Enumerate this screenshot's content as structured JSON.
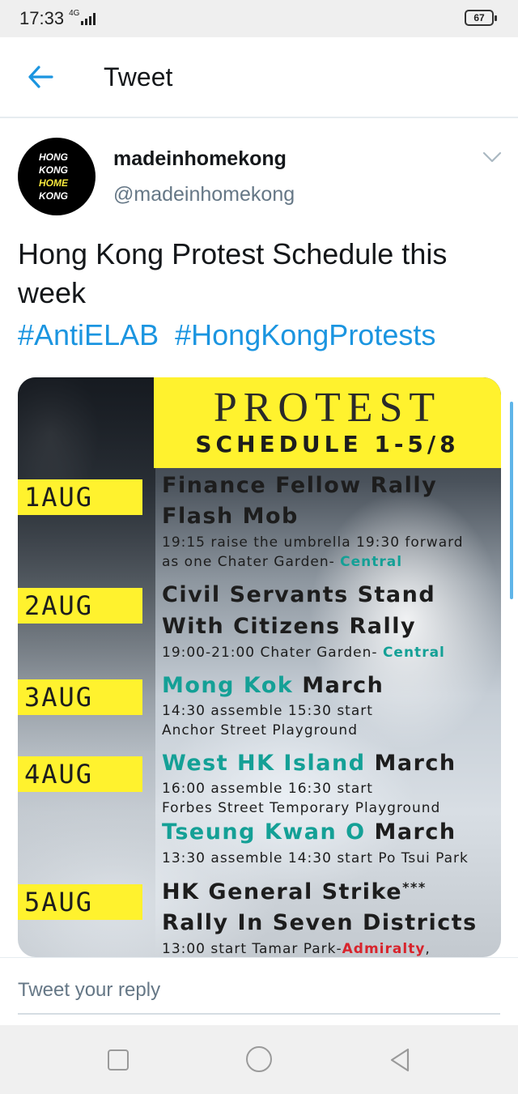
{
  "status_bar": {
    "time": "17:33",
    "network": "4G",
    "battery": "67"
  },
  "app_bar": {
    "title": "Tweet",
    "back_icon": "arrow-left-icon"
  },
  "tweet": {
    "avatar": {
      "line1": "HONG",
      "line2": "KONG",
      "line3": "HOME",
      "line4": "KONG"
    },
    "display_name": "madeinhomekong",
    "handle": "@madeinhomekong",
    "text": "Hong Kong Protest Schedule this week",
    "hashtags": [
      "#AntiELAB",
      "#HongKongProtests"
    ]
  },
  "poster": {
    "title": "PROTEST",
    "subtitle": "SCHEDULE 1-5/8",
    "days": [
      {
        "tag": "1AUG",
        "lines": [
          {
            "parts": [
              {
                "text": "Finance Fellow Rally",
                "style": ""
              }
            ]
          },
          {
            "parts": [
              {
                "text": "Flash Mob",
                "style": ""
              }
            ]
          }
        ],
        "subs": [
          {
            "parts": [
              {
                "text": "19:15 raise the umbrella  19:30 forward",
                "style": ""
              }
            ]
          },
          {
            "parts": [
              {
                "text": "as one  Chater Garden- ",
                "style": ""
              },
              {
                "text": "Central",
                "style": "teal"
              }
            ]
          }
        ]
      },
      {
        "tag": "2AUG",
        "lines": [
          {
            "parts": [
              {
                "text": "Civil Servants Stand",
                "style": ""
              }
            ]
          },
          {
            "parts": [
              {
                "text": "With Citizens Rally",
                "style": ""
              }
            ]
          }
        ],
        "subs": [
          {
            "parts": [
              {
                "text": "19:00-21:00  Chater Garden- ",
                "style": ""
              },
              {
                "text": "Central",
                "style": "teal"
              }
            ]
          }
        ]
      },
      {
        "tag": "3AUG",
        "lines": [
          {
            "parts": [
              {
                "text": "Mong Kok",
                "style": "teal"
              },
              {
                "text": " March",
                "style": ""
              }
            ]
          }
        ],
        "subs": [
          {
            "parts": [
              {
                "text": "14:30 assemble  15:30 start",
                "style": ""
              }
            ]
          },
          {
            "parts": [
              {
                "text": "Anchor Street Playground",
                "style": ""
              }
            ]
          }
        ]
      },
      {
        "tag": "4AUG",
        "lines": [
          {
            "parts": [
              {
                "text": "West HK Island",
                "style": "teal"
              },
              {
                "text": " March",
                "style": ""
              }
            ]
          }
        ],
        "subs": [
          {
            "parts": [
              {
                "text": "16:00 assemble  16:30 start",
                "style": ""
              }
            ]
          },
          {
            "parts": [
              {
                "text": "Forbes Street Temporary Playground",
                "style": ""
              }
            ]
          }
        ],
        "extra_title": {
          "parts": [
            {
              "text": "Tseung Kwan O",
              "style": "teal"
            },
            {
              "text": " March",
              "style": ""
            }
          ]
        },
        "extra_sub": {
          "parts": [
            {
              "text": "13:30 assemble  14:30 start  Po Tsui Park",
              "style": ""
            }
          ]
        }
      },
      {
        "tag": "5AUG",
        "lines": [
          {
            "parts": [
              {
                "text": "HK General Strike",
                "style": ""
              },
              {
                "text": "***",
                "style": "sup"
              }
            ]
          },
          {
            "parts": [
              {
                "text": "Rally In Seven Districts",
                "style": ""
              }
            ]
          }
        ],
        "subs": [
          {
            "parts": [
              {
                "text": "13:00 start  Tamar Park-",
                "style": ""
              },
              {
                "text": "Admiralty",
                "style": "red"
              },
              {
                "text": ",",
                "style": ""
              }
            ]
          }
        ]
      }
    ]
  },
  "reply": {
    "placeholder": "Tweet your reply"
  },
  "nav": {
    "recents_icon": "square-icon",
    "home_icon": "circle-icon",
    "back_icon": "triangle-back-icon"
  }
}
